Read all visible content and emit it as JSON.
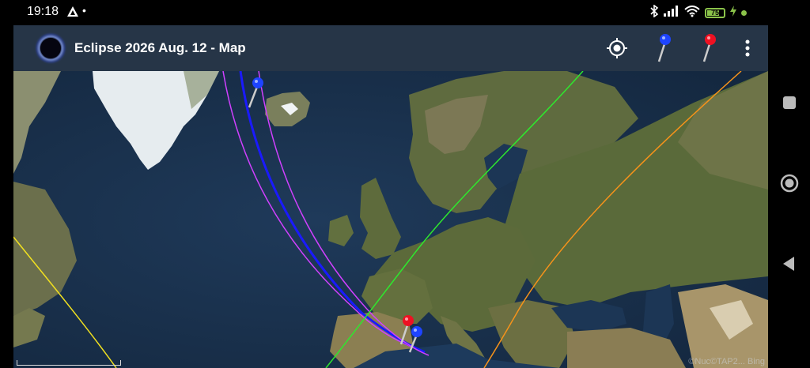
{
  "status_bar": {
    "time": "19:18",
    "battery_level": 75,
    "battery_label": "75",
    "icons": [
      "notification-triangle-icon",
      "bluetooth-icon",
      "signal-icon",
      "wifi-icon",
      "battery-icon",
      "charging-icon"
    ]
  },
  "app_bar": {
    "title": "Eclipse 2026 Aug. 12 - Map",
    "actions": [
      "my-location-icon",
      "blue-pin-icon",
      "red-pin-icon",
      "more-options-icon"
    ]
  },
  "map": {
    "attribution": "©Nuc©TAP2... Bing",
    "line_colors": {
      "central_line": "#1a1aff",
      "limits": "#d040ff",
      "green_line": "#2ee82e",
      "orange_line": "#f7931a",
      "yellow_line": "#f0e020"
    },
    "markers": [
      {
        "name": "blue-pin",
        "color": "#1e44ff"
      },
      {
        "name": "red-pin",
        "color": "#ee1122"
      },
      {
        "name": "blue-pin",
        "color": "#1e44ff"
      }
    ]
  },
  "colors": {
    "app_bar": "#263547",
    "status_bar": "#000000",
    "battery_green": "#8bc34a"
  }
}
